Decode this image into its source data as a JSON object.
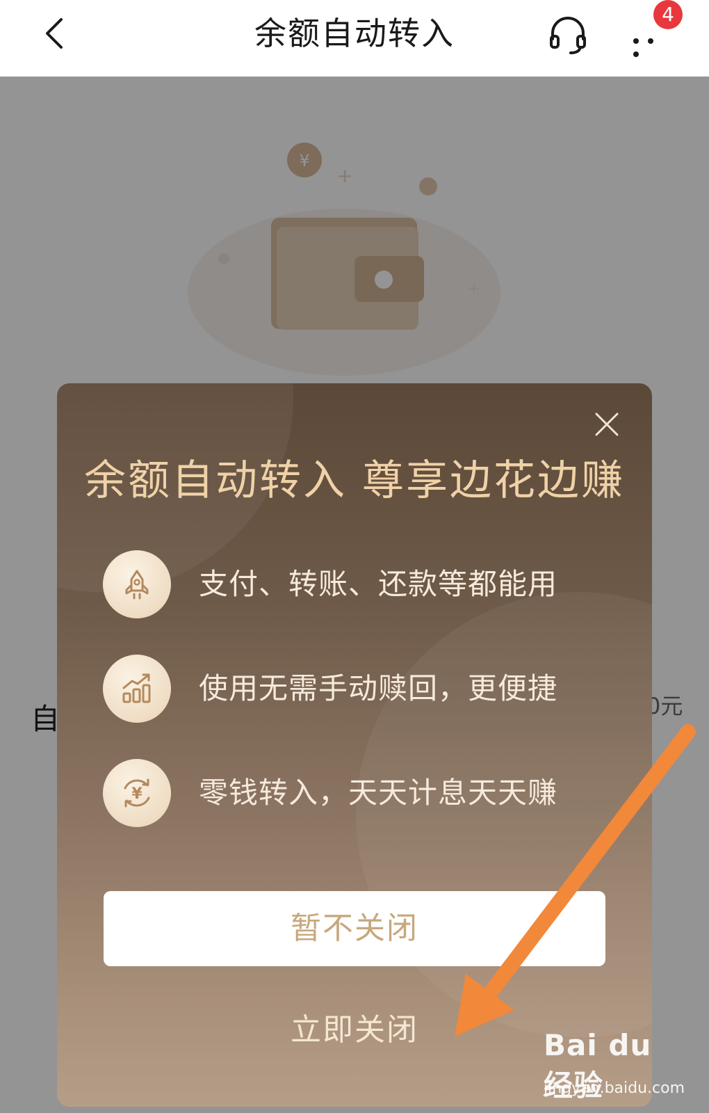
{
  "header": {
    "title": "余额自动转入",
    "back_icon": "chevron-left-icon",
    "service_icon": "headset-icon",
    "more_icon": "more-dots-icon",
    "badge_count": "4"
  },
  "background_page": {
    "row_label": "自",
    "row_value": "0元"
  },
  "modal": {
    "title": "余额自动转入 尊享边花边赚",
    "features": [
      {
        "icon": "rocket-icon",
        "text": "支付、转账、还款等都能用"
      },
      {
        "icon": "growth-chart-icon",
        "text": "使用无需手动赎回，更便捷"
      },
      {
        "icon": "yuan-cycle-icon",
        "text": "零钱转入，天天计息天天赚"
      }
    ],
    "keep_button": "暂不关闭",
    "close_now_button": "立即关闭"
  },
  "watermark": {
    "logo": "Bai du 经验",
    "url": "jingyan.baidu.com"
  },
  "colors": {
    "modal_title": "#f0d2a8",
    "keep_button_text": "#c8a77e",
    "badge": "#e8383d",
    "arrow": "#f2883a"
  }
}
